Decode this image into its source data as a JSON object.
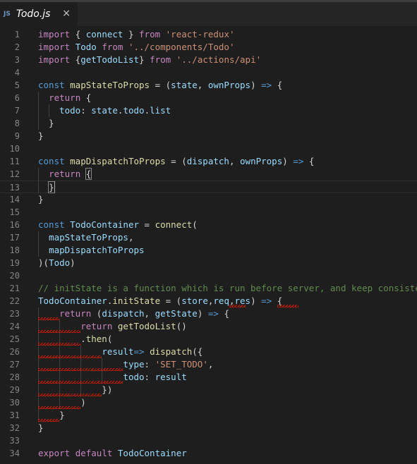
{
  "tab": {
    "icon_label": "JS",
    "title": "Todo.js",
    "close_glyph": "×"
  },
  "colors": {
    "background": "#1e1e1e",
    "keyword": "#c586c0",
    "storage": "#569cd6",
    "string": "#ce9178",
    "variable": "#9cdcfe",
    "function": "#dcdcaa",
    "comment": "#608b4e",
    "error_squiggle": "#e51400"
  },
  "editor": {
    "active_line": 13,
    "lines": [
      {
        "n": "1",
        "tokens": [
          [
            "kw",
            "import "
          ],
          [
            "op",
            "{ "
          ],
          [
            "var",
            "connect"
          ],
          [
            "op",
            " } "
          ],
          [
            "kw",
            "from "
          ],
          [
            "str",
            "'react-redux'"
          ]
        ]
      },
      {
        "n": "2",
        "tokens": [
          [
            "kw",
            "import "
          ],
          [
            "var",
            "Todo"
          ],
          [
            "kw",
            " from "
          ],
          [
            "str",
            "'../components/Todo'"
          ]
        ]
      },
      {
        "n": "3",
        "tokens": [
          [
            "kw",
            "import "
          ],
          [
            "op",
            "{"
          ],
          [
            "var",
            "getTodoList"
          ],
          [
            "op",
            "} "
          ],
          [
            "kw",
            "from "
          ],
          [
            "str",
            "'../actions/api'"
          ]
        ]
      },
      {
        "n": "4",
        "tokens": []
      },
      {
        "n": "5",
        "tokens": [
          [
            "kwb",
            "const "
          ],
          [
            "fn",
            "mapStateToProps"
          ],
          [
            "op",
            " = ("
          ],
          [
            "var",
            "state"
          ],
          [
            "op",
            ", "
          ],
          [
            "var",
            "ownProps"
          ],
          [
            "op",
            ") "
          ],
          [
            "kwb",
            "=>"
          ],
          [
            "op",
            " {"
          ]
        ]
      },
      {
        "n": "6",
        "tokens": [
          [
            "op",
            "  "
          ],
          [
            "kw",
            "return"
          ],
          [
            "op",
            " {"
          ]
        ]
      },
      {
        "n": "7",
        "tokens": [
          [
            "op",
            "    "
          ],
          [
            "var",
            "todo"
          ],
          [
            "op",
            ": "
          ],
          [
            "var",
            "state"
          ],
          [
            "op",
            "."
          ],
          [
            "var",
            "todo"
          ],
          [
            "op",
            "."
          ],
          [
            "var",
            "list"
          ]
        ]
      },
      {
        "n": "8",
        "tokens": [
          [
            "op",
            "  }"
          ]
        ]
      },
      {
        "n": "9",
        "tokens": [
          [
            "op",
            "}"
          ]
        ]
      },
      {
        "n": "10",
        "tokens": []
      },
      {
        "n": "11",
        "tokens": [
          [
            "kwb",
            "const "
          ],
          [
            "fn",
            "mapDispatchToProps"
          ],
          [
            "op",
            " = ("
          ],
          [
            "var",
            "dispatch"
          ],
          [
            "op",
            ", "
          ],
          [
            "var",
            "ownProps"
          ],
          [
            "op",
            ") "
          ],
          [
            "kwb",
            "=>"
          ],
          [
            "op",
            " {"
          ]
        ]
      },
      {
        "n": "12",
        "tokens": [
          [
            "op",
            "  "
          ],
          [
            "kw",
            "return"
          ],
          [
            "op",
            " "
          ],
          [
            "box",
            "{"
          ]
        ]
      },
      {
        "n": "13",
        "tokens": [
          [
            "op",
            "  "
          ],
          [
            "box",
            "}"
          ]
        ]
      },
      {
        "n": "14",
        "tokens": [
          [
            "op",
            "}"
          ]
        ]
      },
      {
        "n": "15",
        "tokens": []
      },
      {
        "n": "16",
        "tokens": [
          [
            "kwb",
            "const "
          ],
          [
            "var",
            "TodoContainer"
          ],
          [
            "op",
            " = "
          ],
          [
            "fn",
            "connect"
          ],
          [
            "op",
            "("
          ]
        ]
      },
      {
        "n": "17",
        "tokens": [
          [
            "op",
            "  "
          ],
          [
            "var",
            "mapStateToProps"
          ],
          [
            "op",
            ","
          ]
        ]
      },
      {
        "n": "18",
        "tokens": [
          [
            "op",
            "  "
          ],
          [
            "var",
            "mapDispatchToProps"
          ]
        ]
      },
      {
        "n": "19",
        "tokens": [
          [
            "op",
            ")("
          ],
          [
            "var",
            "Todo"
          ],
          [
            "op",
            ")"
          ]
        ]
      },
      {
        "n": "20",
        "tokens": []
      },
      {
        "n": "21",
        "tokens": [
          [
            "com",
            "// initState is a function which is run before server, and keep consistency"
          ]
        ]
      },
      {
        "n": "22",
        "tokens": [
          [
            "var",
            "TodoContainer"
          ],
          [
            "op",
            "."
          ],
          [
            "fn",
            "initState"
          ],
          [
            "op",
            " = ("
          ],
          [
            "var",
            "store"
          ],
          [
            "op",
            ","
          ],
          [
            "var",
            "req"
          ],
          [
            "op",
            ","
          ],
          [
            "var",
            "res"
          ],
          [
            "op",
            ") "
          ],
          [
            "kwb",
            "=>"
          ],
          [
            "op",
            " {"
          ]
        ]
      },
      {
        "n": "23",
        "tokens": [
          [
            "op",
            "    "
          ],
          [
            "kw",
            "return"
          ],
          [
            "op",
            " ("
          ],
          [
            "var",
            "dispatch"
          ],
          [
            "op",
            ", "
          ],
          [
            "var",
            "getState"
          ],
          [
            "op",
            ") "
          ],
          [
            "kwb",
            "=>"
          ],
          [
            "op",
            " {"
          ]
        ]
      },
      {
        "n": "24",
        "tokens": [
          [
            "op",
            "        "
          ],
          [
            "kw",
            "return"
          ],
          [
            "op",
            " "
          ],
          [
            "fn",
            "getTodoList"
          ],
          [
            "op",
            "()"
          ]
        ]
      },
      {
        "n": "25",
        "tokens": [
          [
            "op",
            "        ."
          ],
          [
            "fn",
            "then"
          ],
          [
            "op",
            "("
          ]
        ]
      },
      {
        "n": "26",
        "tokens": [
          [
            "op",
            "            "
          ],
          [
            "var",
            "result"
          ],
          [
            "kwb",
            "=>"
          ],
          [
            "op",
            " "
          ],
          [
            "fn",
            "dispatch"
          ],
          [
            "op",
            "({"
          ]
        ]
      },
      {
        "n": "27",
        "tokens": [
          [
            "op",
            "                "
          ],
          [
            "var",
            "type"
          ],
          [
            "op",
            ": "
          ],
          [
            "str",
            "'SET_TODO'"
          ],
          [
            "op",
            ","
          ]
        ]
      },
      {
        "n": "28",
        "tokens": [
          [
            "op",
            "                "
          ],
          [
            "var",
            "todo"
          ],
          [
            "op",
            ": "
          ],
          [
            "var",
            "result"
          ]
        ]
      },
      {
        "n": "29",
        "tokens": [
          [
            "op",
            "            })"
          ]
        ]
      },
      {
        "n": "30",
        "tokens": [
          [
            "op",
            "        )"
          ]
        ]
      },
      {
        "n": "31",
        "tokens": [
          [
            "op",
            "    }"
          ]
        ]
      },
      {
        "n": "32",
        "tokens": [
          [
            "op",
            "}"
          ]
        ]
      },
      {
        "n": "33",
        "tokens": []
      },
      {
        "n": "34",
        "tokens": [
          [
            "kw",
            "export"
          ],
          [
            "op",
            " "
          ],
          [
            "kw",
            "default"
          ],
          [
            "op",
            " "
          ],
          [
            "var",
            "TodoContainer"
          ]
        ]
      }
    ]
  }
}
